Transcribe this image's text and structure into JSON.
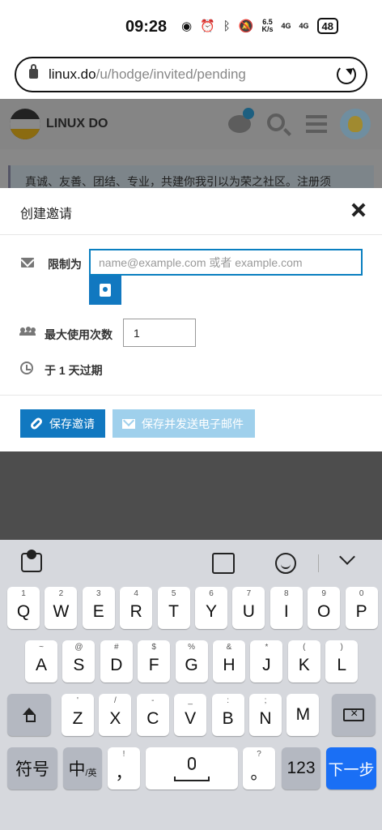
{
  "status_bar": {
    "time": "09:28",
    "net_speed_top": "6.5",
    "net_speed_bottom": "K/s",
    "signal1": "4G",
    "signal2": "4G",
    "battery": "48"
  },
  "browser": {
    "url_host": "linux.do",
    "url_path": "/u/hodge/invited/pending"
  },
  "site": {
    "name": "LINUX DO",
    "announcement": "真诚、友善、团结、专业，共建你我引以为荣之社区。注册须"
  },
  "modal": {
    "title": "创建邀请",
    "restrict_label": "限制为",
    "email_placeholder": "name@example.com 或者 example.com",
    "max_uses_label": "最大使用次数",
    "max_uses_value": "1",
    "expiry_text": "于 1 天过期",
    "save_button": "保存邀请",
    "save_send_button": "保存并发送电子邮件",
    "colors": {
      "primary": "#1178c0",
      "disabled": "#9fd0ec"
    }
  },
  "keyboard": {
    "row1": [
      {
        "hint": "1",
        "key": "Q"
      },
      {
        "hint": "2",
        "key": "W"
      },
      {
        "hint": "3",
        "key": "E"
      },
      {
        "hint": "4",
        "key": "R"
      },
      {
        "hint": "5",
        "key": "T"
      },
      {
        "hint": "6",
        "key": "Y"
      },
      {
        "hint": "7",
        "key": "U"
      },
      {
        "hint": "8",
        "key": "I"
      },
      {
        "hint": "9",
        "key": "O"
      },
      {
        "hint": "0",
        "key": "P"
      }
    ],
    "row2": [
      {
        "hint": "~",
        "key": "A"
      },
      {
        "hint": "@",
        "key": "S"
      },
      {
        "hint": "#",
        "key": "D"
      },
      {
        "hint": "$",
        "key": "F"
      },
      {
        "hint": "%",
        "key": "G"
      },
      {
        "hint": "&",
        "key": "H"
      },
      {
        "hint": "*",
        "key": "J"
      },
      {
        "hint": "(",
        "key": "K"
      },
      {
        "hint": ")",
        "key": "L"
      }
    ],
    "row3": [
      {
        "hint": "'",
        "key": "Z"
      },
      {
        "hint": "/",
        "key": "X"
      },
      {
        "hint": "-",
        "key": "C"
      },
      {
        "hint": "_",
        "key": "V"
      },
      {
        "hint": ":",
        "key": "B"
      },
      {
        "hint": ";",
        "key": "N"
      },
      {
        "hint": "",
        "key": "M"
      }
    ],
    "symbols_key": "符号",
    "lang_key_main": "中",
    "lang_key_sub": "/英",
    "comma_hint": "!",
    "comma_key": "，",
    "period_hint": "?",
    "period_key": "。",
    "num_key": "123",
    "next_key": "下一步"
  }
}
